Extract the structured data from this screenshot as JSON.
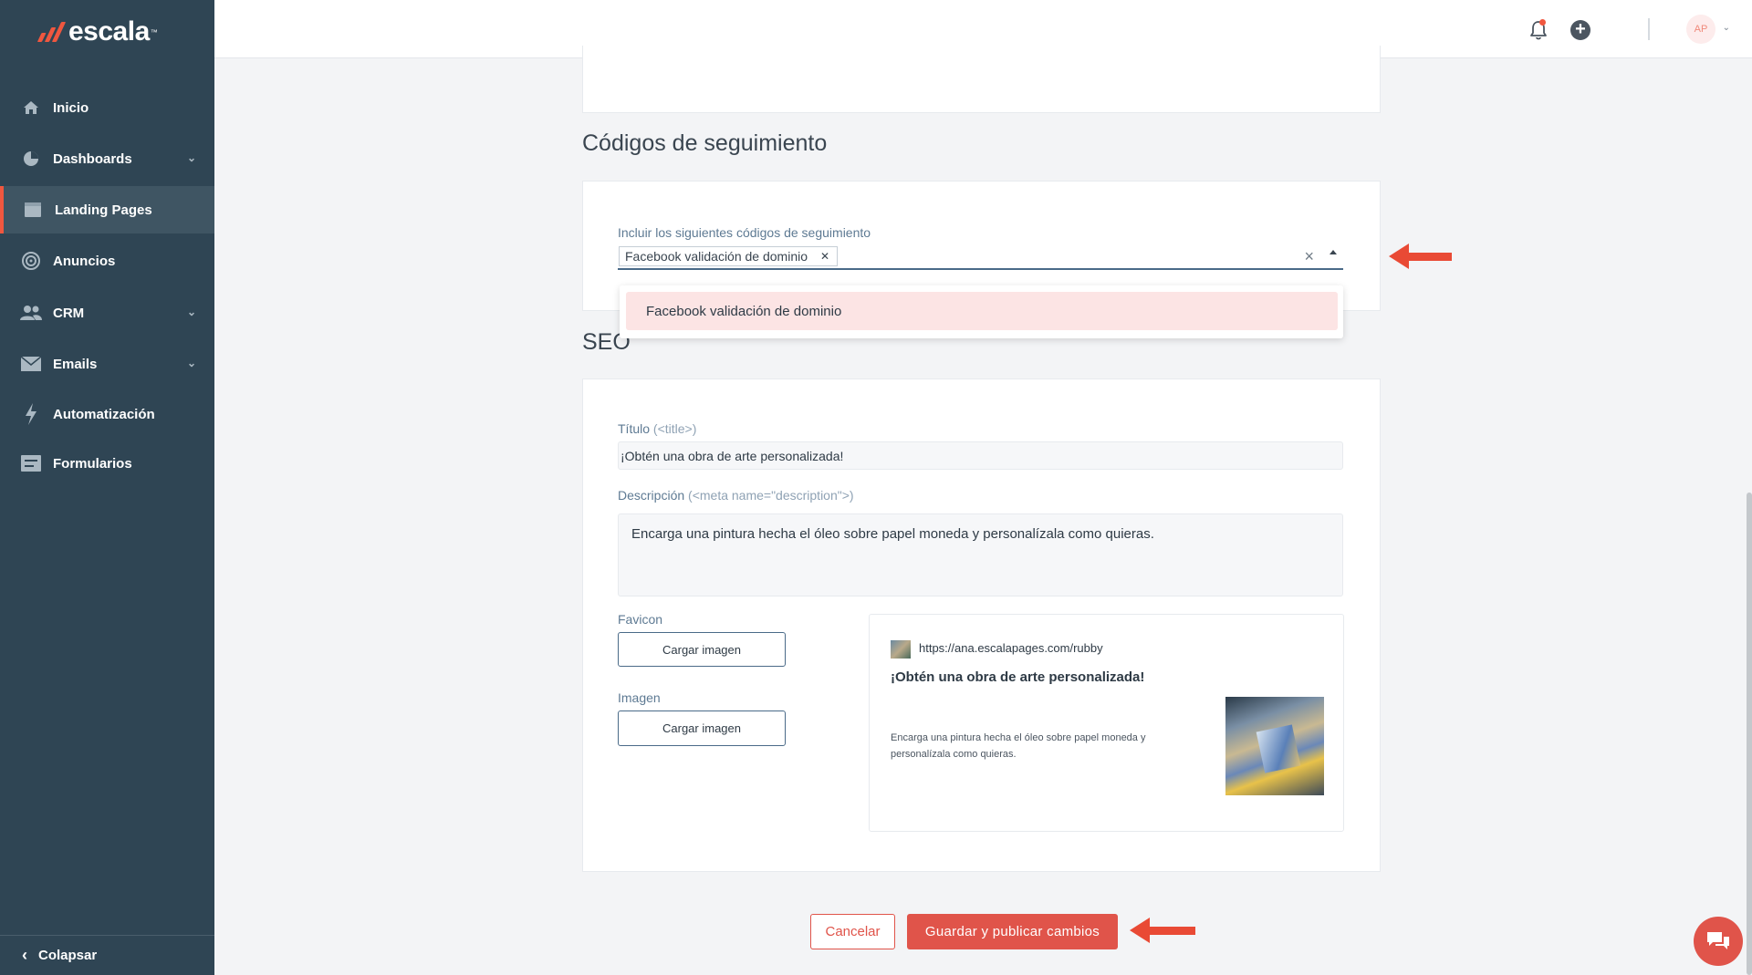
{
  "brand": {
    "name": "escala",
    "tm": "™",
    "accent": "#f0573f",
    "sidebar_bg": "#2f4554"
  },
  "sidebar": {
    "items": [
      {
        "label": "Inicio",
        "icon": "home-icon",
        "has_submenu": false,
        "active": false
      },
      {
        "label": "Dashboards",
        "icon": "pie-chart-icon",
        "has_submenu": true,
        "active": false
      },
      {
        "label": "Landing Pages",
        "icon": "browser-window-icon",
        "has_submenu": false,
        "active": true
      },
      {
        "label": "Anuncios",
        "icon": "target-icon",
        "has_submenu": false,
        "active": false
      },
      {
        "label": "CRM",
        "icon": "users-icon",
        "has_submenu": true,
        "active": false
      },
      {
        "label": "Emails",
        "icon": "envelope-icon",
        "has_submenu": true,
        "active": false
      },
      {
        "label": "Automatización",
        "icon": "lightning-icon",
        "has_submenu": false,
        "active": false
      },
      {
        "label": "Formularios",
        "icon": "form-icon",
        "has_submenu": false,
        "active": false
      }
    ],
    "collapse_label": "Colapsar"
  },
  "topbar": {
    "avatar_initials": "AP",
    "notification_icon": "bell-icon",
    "add_icon": "plus-circle-icon"
  },
  "tracking": {
    "section_title": "Códigos de seguimiento",
    "field_label": "Incluir los siguientes códigos de seguimiento",
    "selected_chips": [
      "Facebook validación de dominio"
    ],
    "dropdown_options": [
      "Facebook validación de dominio"
    ]
  },
  "seo": {
    "section_title": "SEO",
    "title_label": "Título",
    "title_hint": "(<title>)",
    "title_value": "¡Obtén una obra de arte personalizada!",
    "description_label": "Descripción",
    "description_hint": "(<meta name=\"description\">)",
    "description_value": "Encarga una pintura hecha el óleo sobre papel moneda y personalízala como quieras.",
    "favicon_label": "Favicon",
    "favicon_button": "Cargar imagen",
    "image_label": "Imagen",
    "image_button": "Cargar imagen",
    "preview": {
      "url": "https://ana.escalapages.com/rubby",
      "title": "¡Obtén una obra de arte personalizada!",
      "description": "Encarga una pintura hecha el óleo sobre papel moneda y personalízala como quieras."
    }
  },
  "actions": {
    "cancel_label": "Cancelar",
    "save_label": "Guardar y publicar cambios"
  }
}
